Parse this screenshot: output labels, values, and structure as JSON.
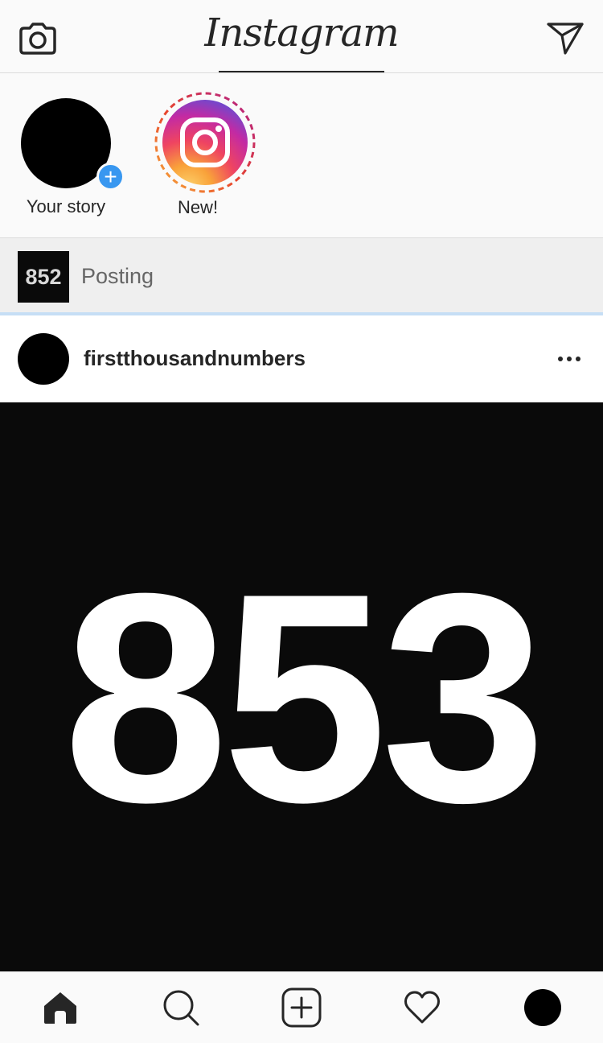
{
  "header": {
    "logo_text": "Instagram",
    "camera_icon": "camera-icon",
    "direct_icon": "paper-plane-icon"
  },
  "stories": [
    {
      "label": "Your story",
      "type": "own",
      "badge": "+"
    },
    {
      "label": "New!",
      "type": "instagram-new"
    }
  ],
  "posting": {
    "thumb_text": "852",
    "label": "Posting"
  },
  "post": {
    "username": "firstthousandnumbers",
    "image_text": "853"
  },
  "tabbar": {
    "items": [
      "home-icon",
      "search-icon",
      "add-icon",
      "heart-icon",
      "profile-icon"
    ]
  },
  "colors": {
    "background": "#fafafa",
    "accent_blue": "#3897f0",
    "posting_bar": "#efefef",
    "progress_line": "#c6def5",
    "post_image_bg": "#0a0a0a"
  }
}
